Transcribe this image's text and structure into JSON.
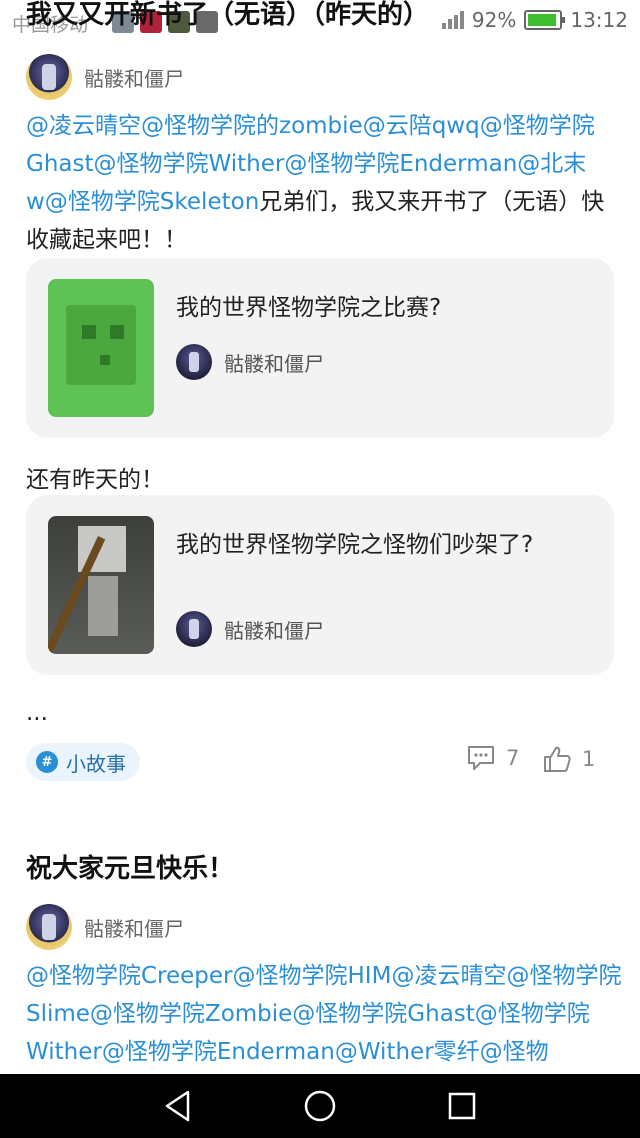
{
  "status_bar": {
    "carrier": "中国移动",
    "battery_percent": "92%",
    "battery_level": 0.92,
    "time": "13:12"
  },
  "header": {
    "post1_title": "我又又开新书了（无语）（昨天的）"
  },
  "post1": {
    "author": "骷髅和僵尸",
    "mentions": "@凌云晴空@怪物学院的zombie@云陪qwq@怪物学院Ghast@怪物学院Wither@怪物学院Enderman@北末w@怪物学院Skeleton",
    "text": "兄弟们，我又来开书了（无语）快收藏起来吧！！",
    "card1": {
      "title": "我的世界怪物学院之比赛?",
      "author": "骷髅和僵尸"
    },
    "between_text": "还有昨天的！",
    "card2": {
      "title": "我的世界怪物学院之怪物们吵架了?",
      "author": "骷髅和僵尸"
    },
    "ellipsis": "...",
    "tag": "小故事",
    "tag_icon": "#",
    "comments": "7",
    "likes": "1"
  },
  "post2": {
    "title": "祝大家元旦快乐！",
    "author": "骷髅和僵尸",
    "mentions": "@怪物学院Creeper@怪物学院HIM@凌云晴空@怪物学院Slime@怪物学院Zombie@怪物学院Ghast@怪物学院Wither@怪物学院Enderman@Wither零纤@怪物"
  },
  "colors": {
    "mention": "#2a8fd6",
    "card_bg": "#f3f3f3",
    "tag_bg": "#eaf4fc",
    "navbar": "#000000"
  },
  "icons": {
    "comment": "comment-icon",
    "like": "thumbs-up-icon",
    "back": "back-triangle-icon",
    "home": "home-circle-icon",
    "recents": "recents-square-icon"
  }
}
